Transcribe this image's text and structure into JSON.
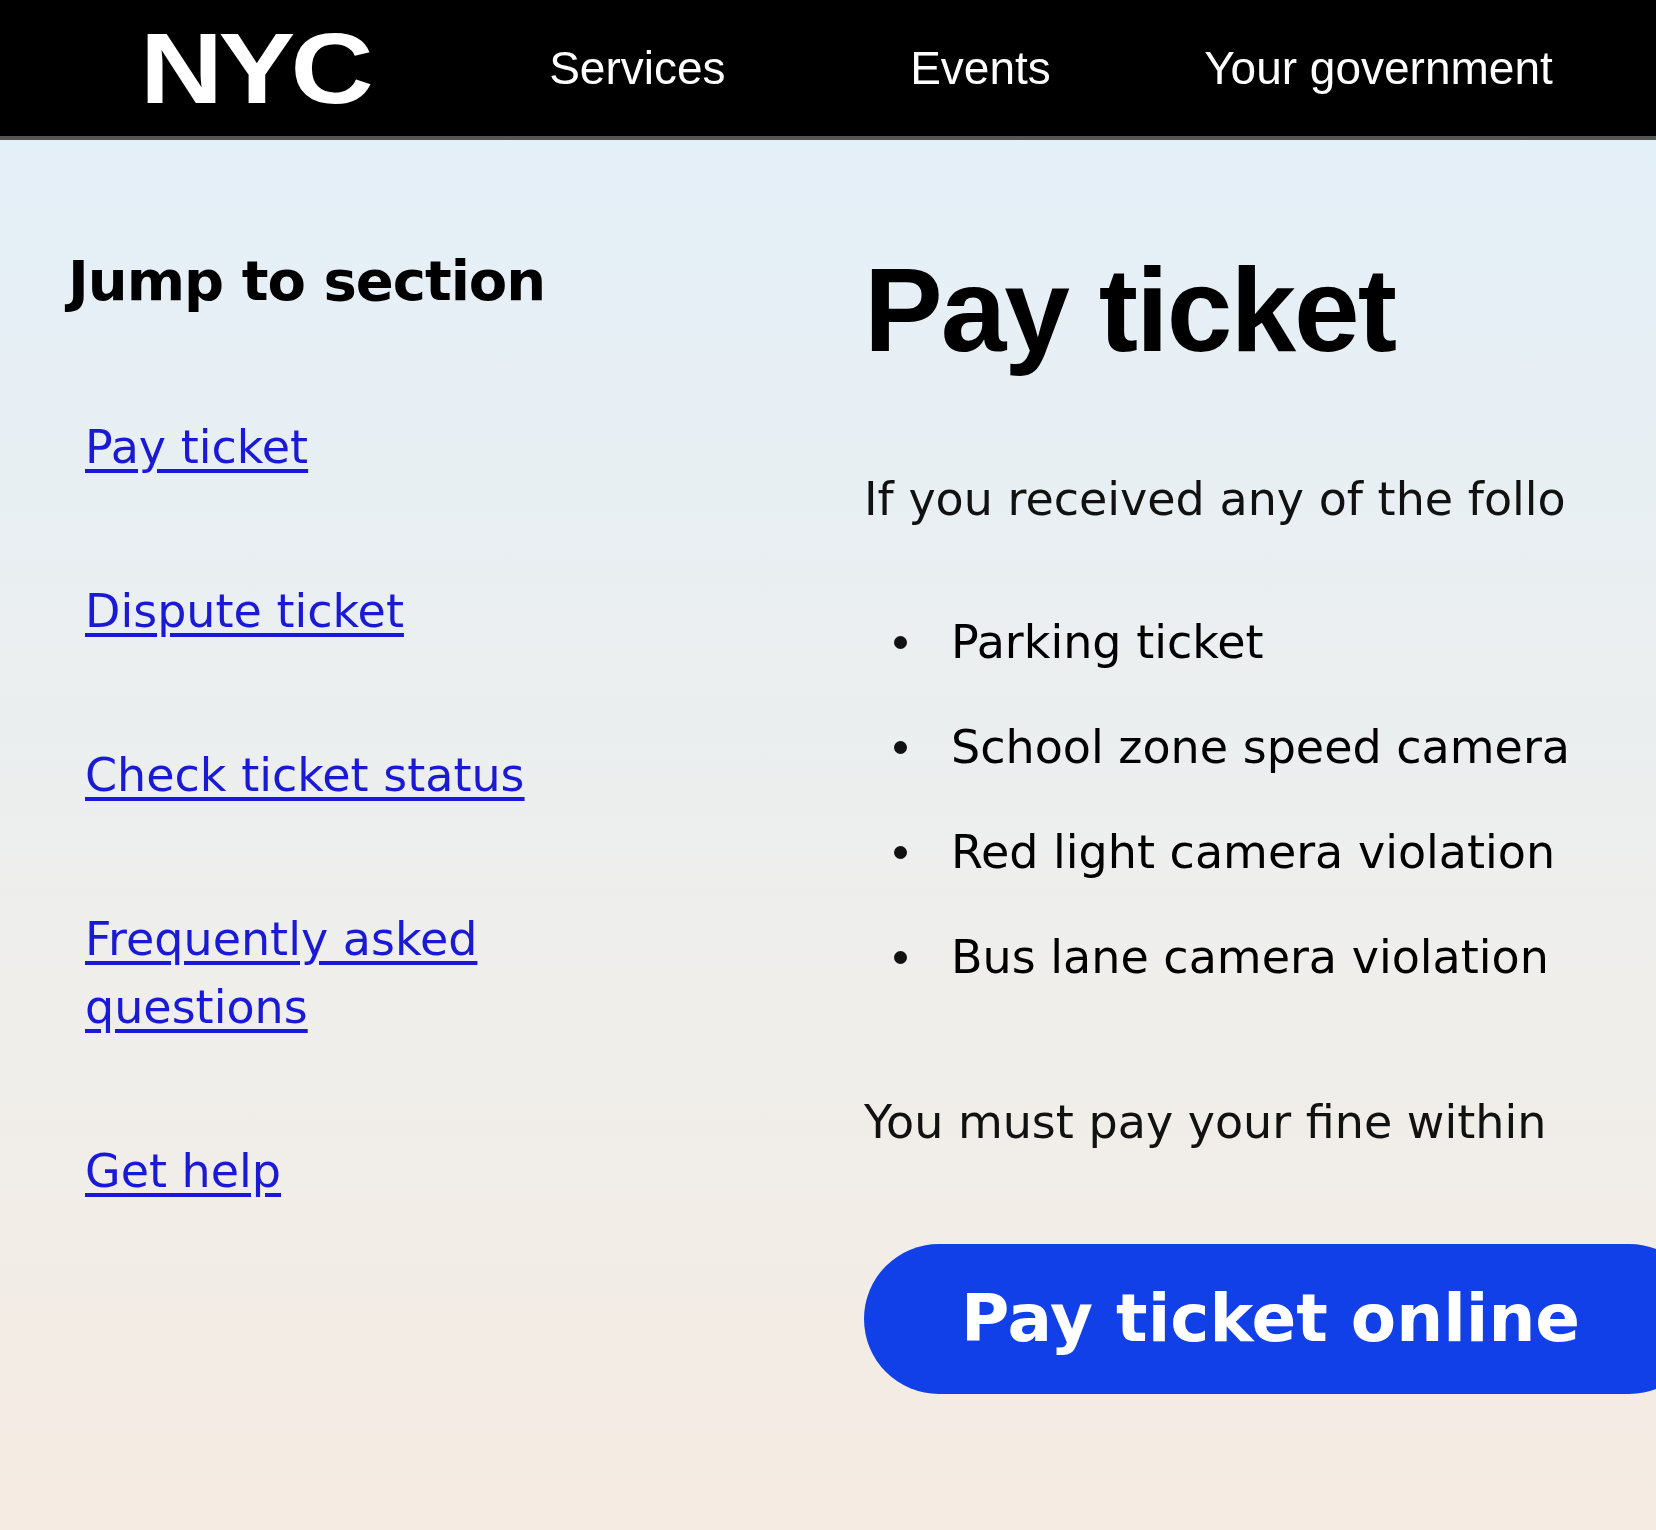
{
  "header": {
    "logo": "NYC",
    "nav": [
      "Services",
      "Events",
      "Your government"
    ]
  },
  "sidebar": {
    "title": "Jump to section",
    "links": [
      "Pay ticket",
      "Dispute ticket",
      "Check ticket status",
      "Frequently asked questions",
      "Get help"
    ]
  },
  "main": {
    "title": "Pay ticket",
    "intro": "If you received any of the follo",
    "items": [
      "Parking ticket",
      "School zone speed camera",
      "Red light camera violation",
      "Bus lane camera violation"
    ],
    "note": "You must pay your fine within",
    "button": "Pay ticket online"
  }
}
